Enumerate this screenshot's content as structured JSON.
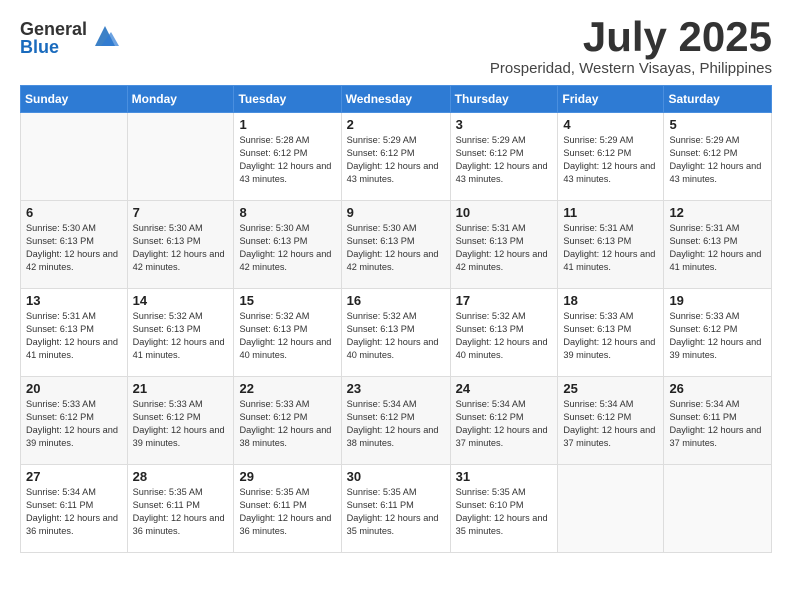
{
  "header": {
    "logo_general": "General",
    "logo_blue": "Blue",
    "month_title": "July 2025",
    "location": "Prosperidad, Western Visayas, Philippines"
  },
  "days_of_week": [
    "Sunday",
    "Monday",
    "Tuesday",
    "Wednesday",
    "Thursday",
    "Friday",
    "Saturday"
  ],
  "weeks": [
    [
      {
        "day": "",
        "info": ""
      },
      {
        "day": "",
        "info": ""
      },
      {
        "day": "1",
        "info": "Sunrise: 5:28 AM\nSunset: 6:12 PM\nDaylight: 12 hours and 43 minutes."
      },
      {
        "day": "2",
        "info": "Sunrise: 5:29 AM\nSunset: 6:12 PM\nDaylight: 12 hours and 43 minutes."
      },
      {
        "day": "3",
        "info": "Sunrise: 5:29 AM\nSunset: 6:12 PM\nDaylight: 12 hours and 43 minutes."
      },
      {
        "day": "4",
        "info": "Sunrise: 5:29 AM\nSunset: 6:12 PM\nDaylight: 12 hours and 43 minutes."
      },
      {
        "day": "5",
        "info": "Sunrise: 5:29 AM\nSunset: 6:12 PM\nDaylight: 12 hours and 43 minutes."
      }
    ],
    [
      {
        "day": "6",
        "info": "Sunrise: 5:30 AM\nSunset: 6:13 PM\nDaylight: 12 hours and 42 minutes."
      },
      {
        "day": "7",
        "info": "Sunrise: 5:30 AM\nSunset: 6:13 PM\nDaylight: 12 hours and 42 minutes."
      },
      {
        "day": "8",
        "info": "Sunrise: 5:30 AM\nSunset: 6:13 PM\nDaylight: 12 hours and 42 minutes."
      },
      {
        "day": "9",
        "info": "Sunrise: 5:30 AM\nSunset: 6:13 PM\nDaylight: 12 hours and 42 minutes."
      },
      {
        "day": "10",
        "info": "Sunrise: 5:31 AM\nSunset: 6:13 PM\nDaylight: 12 hours and 42 minutes."
      },
      {
        "day": "11",
        "info": "Sunrise: 5:31 AM\nSunset: 6:13 PM\nDaylight: 12 hours and 41 minutes."
      },
      {
        "day": "12",
        "info": "Sunrise: 5:31 AM\nSunset: 6:13 PM\nDaylight: 12 hours and 41 minutes."
      }
    ],
    [
      {
        "day": "13",
        "info": "Sunrise: 5:31 AM\nSunset: 6:13 PM\nDaylight: 12 hours and 41 minutes."
      },
      {
        "day": "14",
        "info": "Sunrise: 5:32 AM\nSunset: 6:13 PM\nDaylight: 12 hours and 41 minutes."
      },
      {
        "day": "15",
        "info": "Sunrise: 5:32 AM\nSunset: 6:13 PM\nDaylight: 12 hours and 40 minutes."
      },
      {
        "day": "16",
        "info": "Sunrise: 5:32 AM\nSunset: 6:13 PM\nDaylight: 12 hours and 40 minutes."
      },
      {
        "day": "17",
        "info": "Sunrise: 5:32 AM\nSunset: 6:13 PM\nDaylight: 12 hours and 40 minutes."
      },
      {
        "day": "18",
        "info": "Sunrise: 5:33 AM\nSunset: 6:13 PM\nDaylight: 12 hours and 39 minutes."
      },
      {
        "day": "19",
        "info": "Sunrise: 5:33 AM\nSunset: 6:12 PM\nDaylight: 12 hours and 39 minutes."
      }
    ],
    [
      {
        "day": "20",
        "info": "Sunrise: 5:33 AM\nSunset: 6:12 PM\nDaylight: 12 hours and 39 minutes."
      },
      {
        "day": "21",
        "info": "Sunrise: 5:33 AM\nSunset: 6:12 PM\nDaylight: 12 hours and 39 minutes."
      },
      {
        "day": "22",
        "info": "Sunrise: 5:33 AM\nSunset: 6:12 PM\nDaylight: 12 hours and 38 minutes."
      },
      {
        "day": "23",
        "info": "Sunrise: 5:34 AM\nSunset: 6:12 PM\nDaylight: 12 hours and 38 minutes."
      },
      {
        "day": "24",
        "info": "Sunrise: 5:34 AM\nSunset: 6:12 PM\nDaylight: 12 hours and 37 minutes."
      },
      {
        "day": "25",
        "info": "Sunrise: 5:34 AM\nSunset: 6:12 PM\nDaylight: 12 hours and 37 minutes."
      },
      {
        "day": "26",
        "info": "Sunrise: 5:34 AM\nSunset: 6:11 PM\nDaylight: 12 hours and 37 minutes."
      }
    ],
    [
      {
        "day": "27",
        "info": "Sunrise: 5:34 AM\nSunset: 6:11 PM\nDaylight: 12 hours and 36 minutes."
      },
      {
        "day": "28",
        "info": "Sunrise: 5:35 AM\nSunset: 6:11 PM\nDaylight: 12 hours and 36 minutes."
      },
      {
        "day": "29",
        "info": "Sunrise: 5:35 AM\nSunset: 6:11 PM\nDaylight: 12 hours and 36 minutes."
      },
      {
        "day": "30",
        "info": "Sunrise: 5:35 AM\nSunset: 6:11 PM\nDaylight: 12 hours and 35 minutes."
      },
      {
        "day": "31",
        "info": "Sunrise: 5:35 AM\nSunset: 6:10 PM\nDaylight: 12 hours and 35 minutes."
      },
      {
        "day": "",
        "info": ""
      },
      {
        "day": "",
        "info": ""
      }
    ]
  ]
}
